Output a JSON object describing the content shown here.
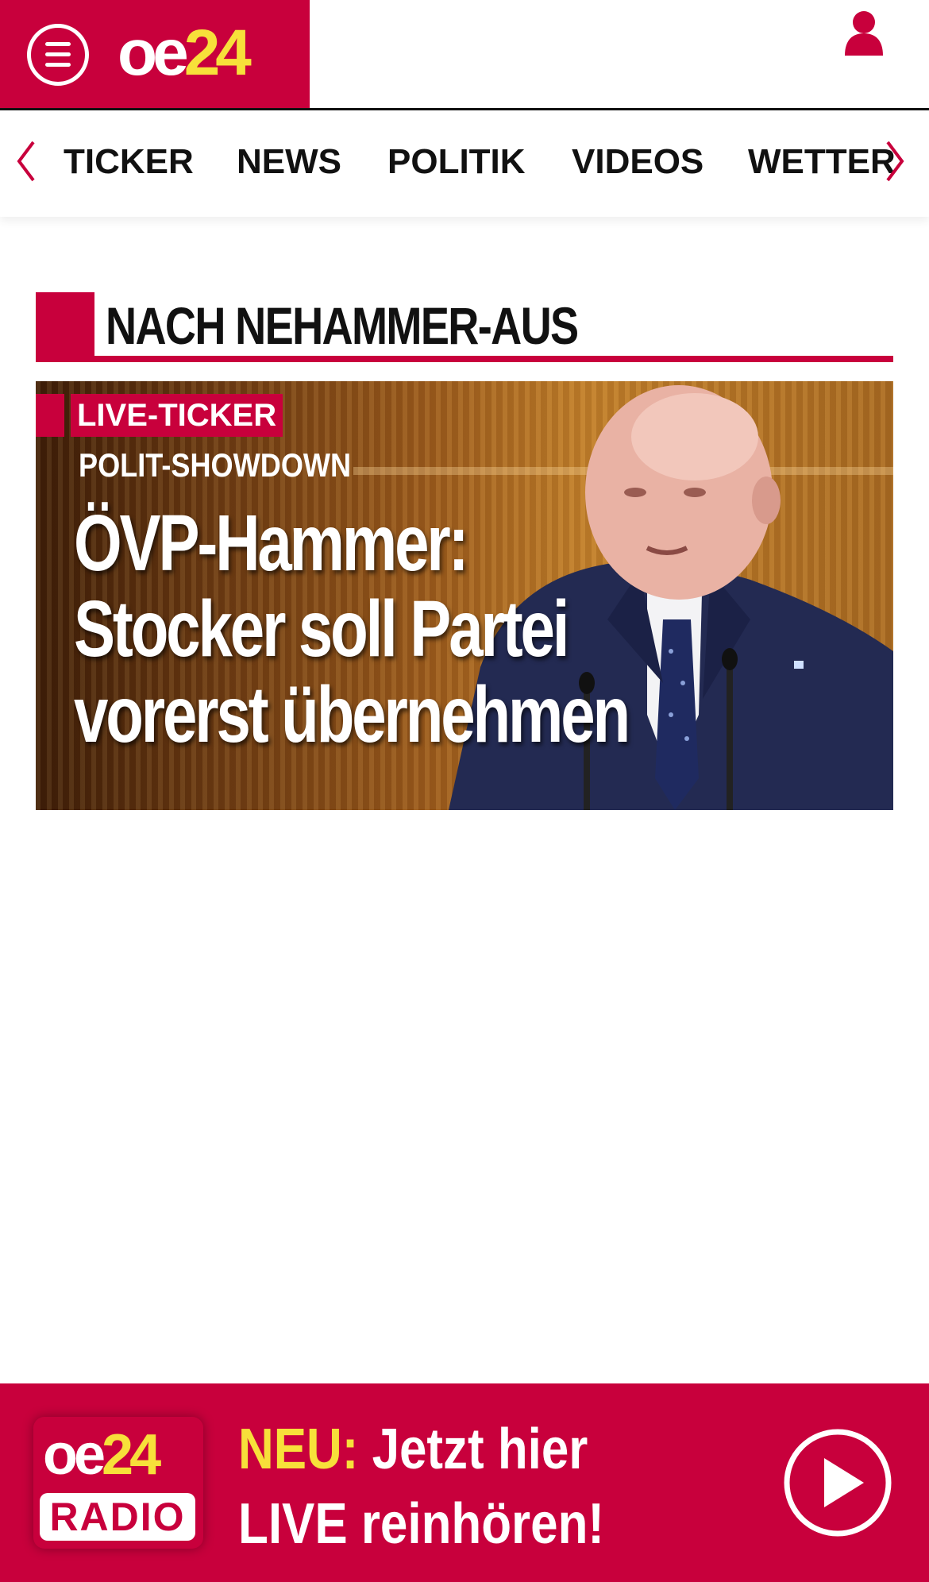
{
  "header": {
    "logo": {
      "part1": "oe",
      "part2": "24"
    },
    "menu_icon": "hamburger-menu-icon",
    "user_icon": "user-icon"
  },
  "nav": {
    "items": [
      "TICKER",
      "NEWS",
      "POLITIK",
      "VIDEOS",
      "WETTER"
    ],
    "prev_icon": "chevron-left-icon",
    "next_icon": "chevron-right-icon"
  },
  "section": {
    "title": "NACH NEHAMMER-AUS"
  },
  "teaser": {
    "badge": "LIVE-TICKER",
    "kicker": "POLIT-SHOWDOWN",
    "headline": "ÖVP-Hammer:\nStocker soll Partei\nvorerst übernehmen"
  },
  "radio_banner": {
    "logo_part1": "oe",
    "logo_part2": "24",
    "logo_word": "RADIO",
    "neu": "NEU:",
    "line1_rest": " Jetzt hier",
    "line2": "LIVE reinhören!",
    "play_icon": "play-icon"
  },
  "colors": {
    "brand_red": "#c8003c",
    "brand_yellow": "#f7e03a"
  }
}
